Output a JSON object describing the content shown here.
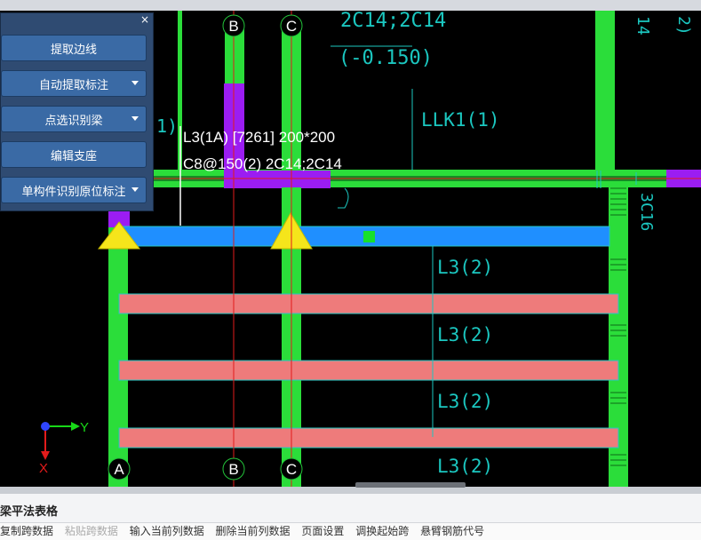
{
  "panel": {
    "close_glyph": "×",
    "buttons": [
      {
        "label": "提取边线",
        "dropdown": false
      },
      {
        "label": "自动提取标注",
        "dropdown": true
      },
      {
        "label": "点选识别梁",
        "dropdown": true
      },
      {
        "label": "编辑支座",
        "dropdown": false
      },
      {
        "label": "单构件识别原位标注",
        "dropdown": true
      }
    ]
  },
  "drawing": {
    "axis_top": [
      "B",
      "C"
    ],
    "axis_bottom": [
      "A",
      "B",
      "C"
    ],
    "beam_label_line1": "L3(1A) [7261] 200*200",
    "beam_label_line2": "C8@150(2) 2C14;2C14",
    "cad_texts": {
      "top_rebar": "2C14;2C14",
      "elevation": "(-0.150)",
      "llk": "LLK1(1)",
      "l3_labels": [
        "L3(2)",
        "L3(2)",
        "L3(2)",
        "L3(2)"
      ],
      "right_vertical": "3C16",
      "top_right_vertical": "14",
      "paren_fragment": "1)",
      "corner_fragment": "2)"
    },
    "ucs": {
      "x_label": "X",
      "y_label": "Y"
    },
    "colors": {
      "column_green": "#2bdd3a",
      "beam_blue": "#1f8fff",
      "beam_pink": "#ee7b7b",
      "beam_purple": "#9b1df2",
      "cad_cyan": "#1bc7c0",
      "grid_red": "#e21b1b",
      "support_yellow": "#f5e51b"
    }
  },
  "bottom": {
    "title": "梁平法表格",
    "toolbar": [
      {
        "label": "复制跨数据",
        "enabled": true
      },
      {
        "label": "粘贴跨数据",
        "enabled": false
      },
      {
        "label": "输入当前列数据",
        "enabled": true
      },
      {
        "label": "删除当前列数据",
        "enabled": true
      },
      {
        "label": "页面设置",
        "enabled": true
      },
      {
        "label": "调换起始跨",
        "enabled": true
      },
      {
        "label": "悬臂钢筋代号",
        "enabled": true
      }
    ]
  }
}
